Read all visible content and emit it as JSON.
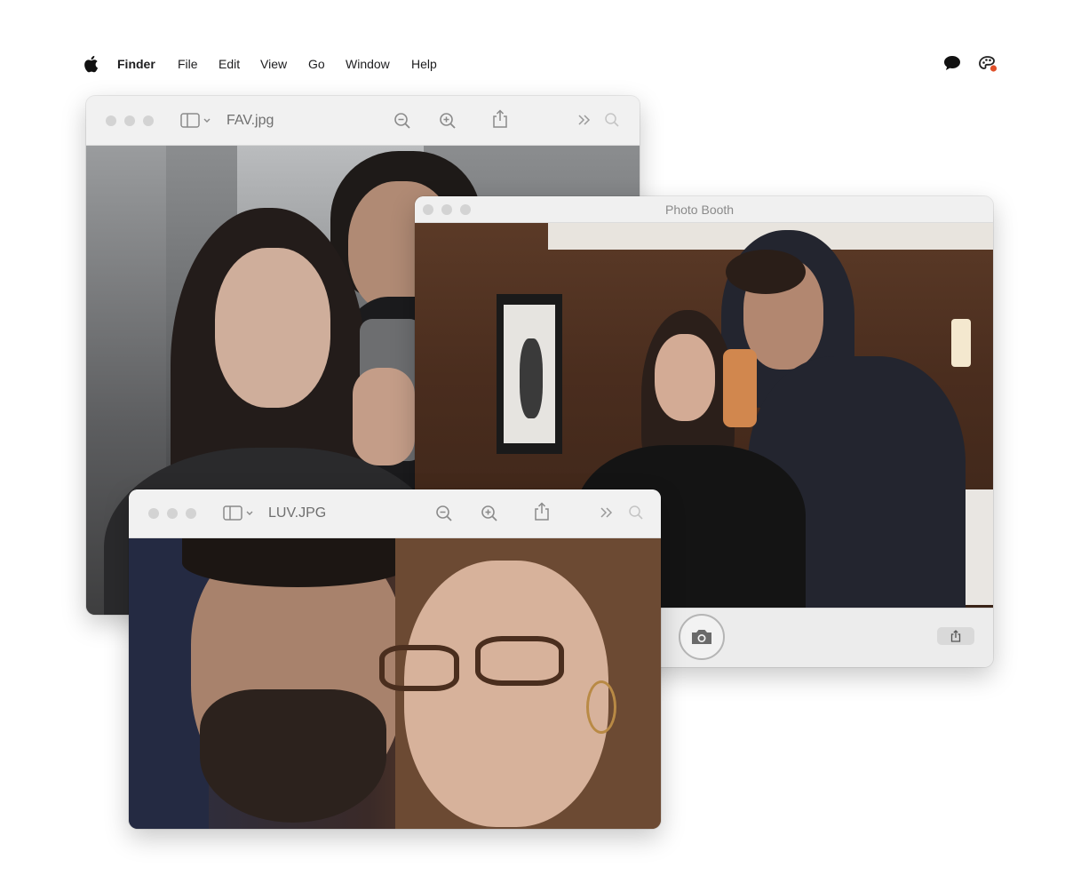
{
  "menubar": {
    "app_name": "Finder",
    "items": [
      "File",
      "Edit",
      "View",
      "Go",
      "Window",
      "Help"
    ],
    "status_icons": [
      "message-bubble-icon",
      "color-palette-icon"
    ]
  },
  "windows": {
    "fav": {
      "title": "FAV.jpg"
    },
    "photobooth": {
      "title": "Photo Booth"
    },
    "luv": {
      "title": "LUV.JPG"
    }
  },
  "icons": {
    "sidebar_toggle": "sidebar-icon",
    "zoom_out": "zoom-out-icon",
    "zoom_in": "zoom-in-icon",
    "share": "share-icon",
    "more": "chevron-double-right-icon",
    "search": "search-icon",
    "camera": "camera-icon"
  },
  "colors": {
    "traffic_light_inactive": "#d3d3d3",
    "titlebar": "#f1f1f1",
    "icon_gray": "#8a8a8a"
  }
}
